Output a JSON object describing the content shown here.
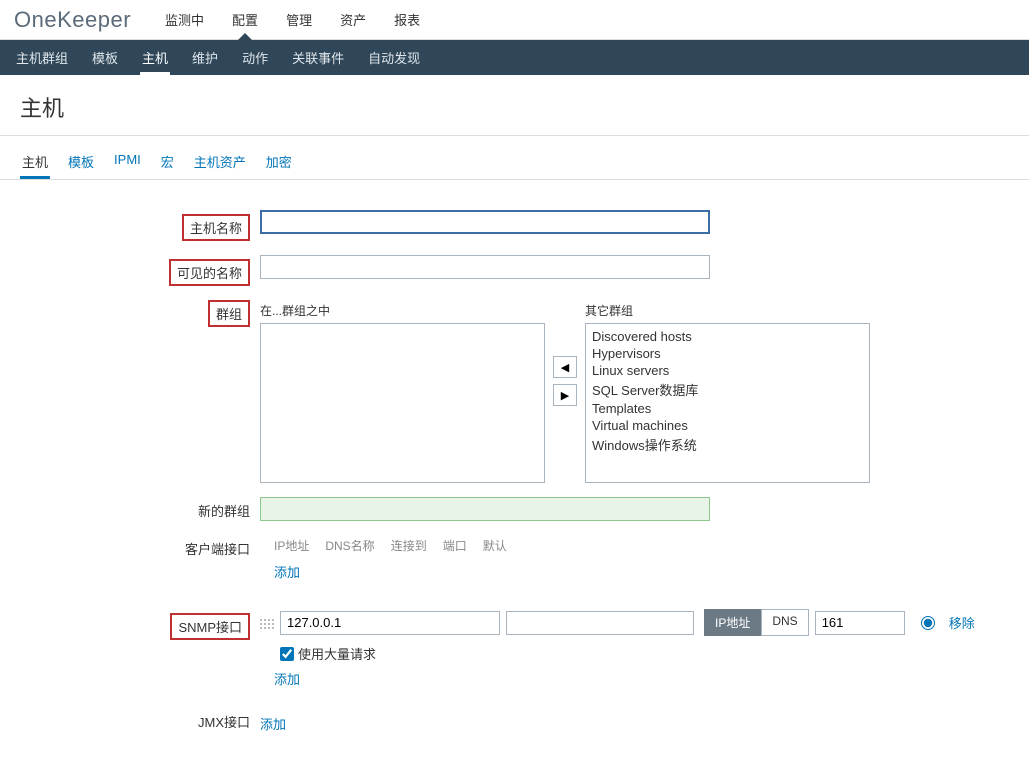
{
  "brand": "OneKeeper",
  "topnav": [
    "监测中",
    "配置",
    "管理",
    "资产",
    "报表"
  ],
  "topnav_active_index": 1,
  "subnav": [
    "主机群组",
    "模板",
    "主机",
    "维护",
    "动作",
    "关联事件",
    "自动发现"
  ],
  "subnav_active_index": 2,
  "page_title": "主机",
  "tabs": [
    "主机",
    "模板",
    "IPMI",
    "宏",
    "主机资产",
    "加密"
  ],
  "tabs_active_index": 0,
  "form": {
    "host_name_label": "主机名称",
    "host_name_value": "",
    "visible_name_label": "可见的名称",
    "visible_name_value": "",
    "groups_label": "群组",
    "groups_in_label": "在...群组之中",
    "other_groups_label": "其它群组",
    "groups_in": [],
    "other_groups": [
      "Discovered hosts",
      "Hypervisors",
      "Linux servers",
      "SQL Server数据库",
      "Templates",
      "Virtual machines",
      "Windows操作系统"
    ],
    "new_group_label": "新的群组",
    "new_group_value": "",
    "client_iface_label": "客户端接口",
    "iface_headers": [
      "IP地址",
      "DNS名称",
      "连接到",
      "端口",
      "默认"
    ],
    "add_link": "添加",
    "snmp_label": "SNMP接口",
    "snmp": {
      "ip": "127.0.0.1",
      "dns": "",
      "connect_ip": "IP地址",
      "connect_dns": "DNS",
      "port": "161",
      "remove": "移除",
      "bulk_label": "使用大量请求",
      "bulk_checked": true
    },
    "jmx_label": "JMX接口"
  }
}
